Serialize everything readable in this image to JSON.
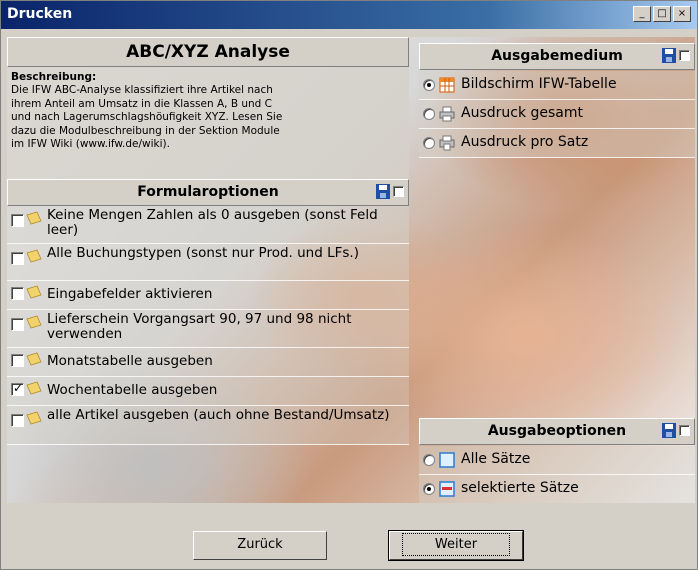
{
  "window": {
    "title": "Drucken"
  },
  "analysis": {
    "title": "ABC/XYZ Analyse",
    "description_heading": "Beschreibung:",
    "description_lines": [
      "Die IFW ABC-Analyse klassifiziert ihre Artikel nach",
      "ihrem Anteil am Umsatz in die Klassen A, B und C",
      "und nach Lagerumschlagshöufigkeit XYZ. Lesen Sie",
      "dazu die Modulbeschreibung in der Sektion Module",
      "im IFW Wiki (www.ifw.de/wiki)."
    ]
  },
  "form_options": {
    "title": "Formularoptionen",
    "items": [
      {
        "label": "Keine Mengen Zahlen als 0 ausgeben (sonst Feld leer)",
        "checked": false
      },
      {
        "label": "Alle Buchungstypen (sonst nur Prod. und LFs.)",
        "checked": false
      },
      {
        "label": "Eingabefelder aktivieren",
        "checked": false
      },
      {
        "label": "Lieferschein Vorgangsart 90, 97 und 98 nicht verwenden",
        "checked": false
      },
      {
        "label": "Monatstabelle ausgeben",
        "checked": false
      },
      {
        "label": "Wochentabelle ausgeben",
        "checked": true
      },
      {
        "label": "alle Artikel ausgeben (auch ohne Bestand/Umsatz)",
        "checked": false
      }
    ]
  },
  "output_medium": {
    "title": "Ausgabemedium",
    "options": [
      {
        "label": "Bildschirm IFW-Tabelle",
        "selected": true,
        "icon": "table-icon"
      },
      {
        "label": "Ausdruck gesamt",
        "selected": false,
        "icon": "printer-icon"
      },
      {
        "label": "Ausdruck pro Satz",
        "selected": false,
        "icon": "printer-record-icon"
      }
    ]
  },
  "output_options": {
    "title": "Ausgabeoptionen",
    "options": [
      {
        "label": "Alle Sätze",
        "selected": false,
        "icon": "all-records-icon"
      },
      {
        "label": "selektierte Sätze",
        "selected": true,
        "icon": "selected-records-icon"
      }
    ]
  },
  "buttons": {
    "back": "Zurück",
    "next": "Weiter"
  },
  "colors": {
    "titlebar": "#0a246a",
    "dialog": "#d4d0c8",
    "save_icon": "#1f4fa3"
  }
}
